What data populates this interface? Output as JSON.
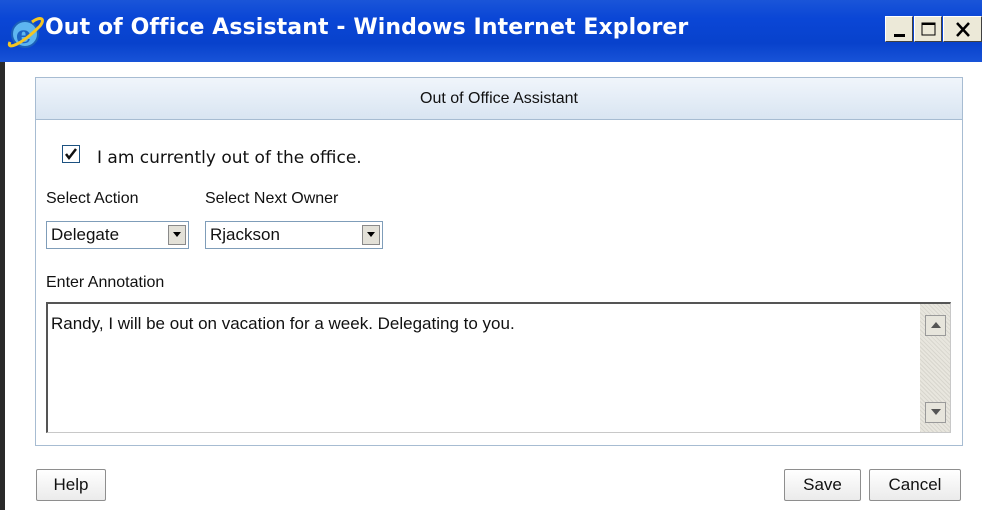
{
  "window": {
    "title": "Out of Office Assistant - Windows Internet Explorer",
    "icon": "internet-explorer-icon",
    "controls": [
      "minimize-icon",
      "maximize-icon",
      "close-icon"
    ]
  },
  "panel": {
    "header": "Out of Office Assistant",
    "out_of_office": {
      "label": "I am currently out of the office.",
      "checked": true
    },
    "select_action": {
      "label": "Select Action",
      "value": "Delegate"
    },
    "select_owner": {
      "label": "Select Next Owner",
      "value": "Rjackson"
    },
    "annotation": {
      "label": "Enter Annotation",
      "value": "Randy, I will be out on vacation for a week. Delegating to you."
    }
  },
  "buttons": {
    "help": "Help",
    "save": "Save",
    "cancel": "Cancel"
  },
  "colors": {
    "titlebar": "#0a46d6",
    "panel_border": "#a7bcd2",
    "panel_header_bg": "#d9e5f2"
  }
}
